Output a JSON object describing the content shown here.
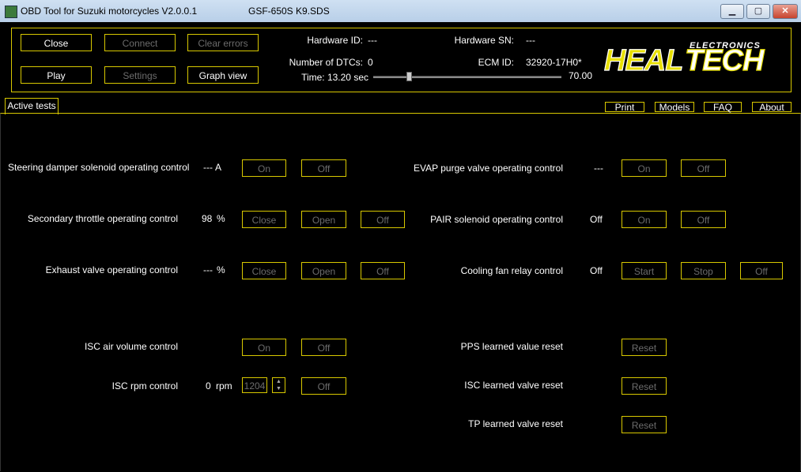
{
  "window": {
    "title": "OBD Tool for Suzuki motorcycles V2.0.0.1",
    "file": "GSF-650S K9.SDS",
    "minimize": "▁",
    "maximize": "▢",
    "close": "✕"
  },
  "toolbar": {
    "close": "Close",
    "connect": "Connect",
    "clear_errors": "Clear errors",
    "play": "Play",
    "settings": "Settings",
    "graph_view": "Graph view"
  },
  "info": {
    "hardware_id_label": "Hardware ID:",
    "hardware_id": "---",
    "hardware_sn_label": "Hardware SN:",
    "hardware_sn": "---",
    "dtc_label": "Number of DTCs:",
    "dtc_value": "0",
    "ecm_label": "ECM ID:",
    "ecm_value": "32920-17H0*",
    "time_label": "Time: 13.20 sec",
    "time_max": "70.00",
    "time_fraction": 0.19
  },
  "logo": {
    "brand": "HEALTECH",
    "sub": "ELECTRONICS"
  },
  "tabs": {
    "active": "Active tests",
    "print": "Print",
    "models": "Models",
    "faq": "FAQ",
    "about": "About"
  },
  "tests": {
    "steering": {
      "label": "Steering damper solenoid operating control",
      "value": "---",
      "unit": "A",
      "on": "On",
      "off": "Off"
    },
    "secondary": {
      "label": "Secondary throttle operating control",
      "value": "98",
      "unit": "%",
      "close": "Close",
      "open": "Open",
      "off": "Off"
    },
    "exhaust": {
      "label": "Exhaust valve operating control",
      "value": "---",
      "unit": "%",
      "close": "Close",
      "open": "Open",
      "off": "Off"
    },
    "isc_air": {
      "label": "ISC air volume control",
      "on": "On",
      "off": "Off"
    },
    "isc_rpm": {
      "label": "ISC rpm control",
      "value": "0",
      "unit": "rpm",
      "spin": "1204",
      "off": "Off"
    },
    "evap": {
      "label": "EVAP purge valve operating control",
      "value": "---",
      "on": "On",
      "off": "Off"
    },
    "pair": {
      "label": "PAIR solenoid operating control",
      "value": "Off",
      "on": "On",
      "off": "Off"
    },
    "fan": {
      "label": "Cooling fan relay control",
      "value": "Off",
      "start": "Start",
      "stop": "Stop",
      "off": "Off"
    },
    "pps": {
      "label": "PPS learned value reset",
      "reset": "Reset"
    },
    "isc_reset": {
      "label": "ISC learned valve reset",
      "reset": "Reset"
    },
    "tp": {
      "label": "TP learned valve reset",
      "reset": "Reset"
    }
  }
}
